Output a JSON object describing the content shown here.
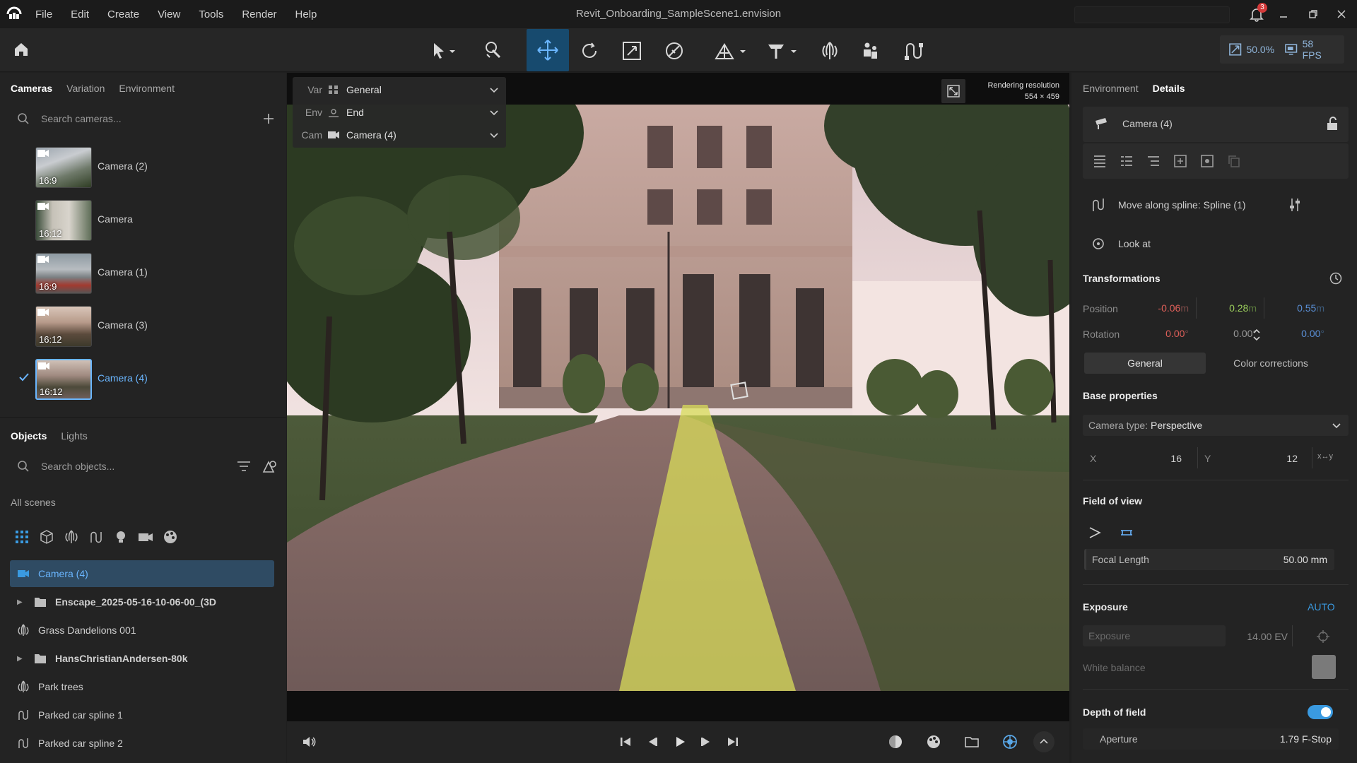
{
  "titlebar": {
    "menu": [
      "File",
      "Edit",
      "Create",
      "View",
      "Tools",
      "Render",
      "Help"
    ],
    "document_title": "Revit_Onboarding_SampleScene1.envision",
    "notification_count": "3"
  },
  "toolbar": {
    "perf_scale": "50.0%",
    "perf_fps": "58 FPS"
  },
  "left": {
    "top_tabs": [
      "Cameras",
      "Variation",
      "Environment"
    ],
    "camera_search_placeholder": "Search cameras...",
    "cameras": [
      {
        "label": "Camera (2)",
        "ratio": "16:9",
        "selected": false
      },
      {
        "label": "Camera",
        "ratio": "16:12",
        "selected": false
      },
      {
        "label": "Camera (1)",
        "ratio": "16:9",
        "selected": false
      },
      {
        "label": "Camera (3)",
        "ratio": "16:12",
        "selected": false
      },
      {
        "label": "Camera (4)",
        "ratio": "16:12",
        "selected": true
      }
    ],
    "bottom_tabs": [
      "Objects",
      "Lights"
    ],
    "object_search_placeholder": "Search objects...",
    "scope_label": "All scenes",
    "objects": [
      {
        "label": "Camera (4)",
        "icon": "camera-icon",
        "expandable": false,
        "selected": true
      },
      {
        "label": "Enscape_2025-05-16-10-06-00_(3D",
        "icon": "folder-icon",
        "expandable": true,
        "selected": false
      },
      {
        "label": "Grass Dandelions 001",
        "icon": "vegetation-icon",
        "expandable": false,
        "selected": false
      },
      {
        "label": "HansChristianAndersen-80k",
        "icon": "folder-icon",
        "expandable": true,
        "selected": false
      },
      {
        "label": "Park trees",
        "icon": "vegetation-icon",
        "expandable": false,
        "selected": false
      },
      {
        "label": "Parked car spline 1",
        "icon": "spline-icon",
        "expandable": false,
        "selected": false
      },
      {
        "label": "Parked car spline 2",
        "icon": "spline-icon",
        "expandable": false,
        "selected": false
      }
    ]
  },
  "viewport": {
    "var_key": "Var",
    "var_value": "General",
    "env_key": "Env",
    "env_value": "End",
    "cam_key": "Cam",
    "cam_value": "Camera (4)",
    "render_res_title": "Rendering resolution",
    "render_res_value": "554 × 459"
  },
  "right": {
    "tabs": [
      "Environment",
      "Details"
    ],
    "object_name": "Camera (4)",
    "spline_label": "Move along spline: Spline (1)",
    "look_at_label": "Look at",
    "transformations_title": "Transformations",
    "position_label": "Position",
    "position": {
      "x": "-0.06",
      "y": "0.28",
      "z": "0.55",
      "unit": "m"
    },
    "rotation_label": "Rotation",
    "rotation": {
      "x": "0.00",
      "y": "0.00",
      "z": "0.00",
      "unit": "°"
    },
    "sub_tabs": [
      "General",
      "Color corrections"
    ],
    "base_props_title": "Base properties",
    "camera_type_label": "Camera type:",
    "camera_type_value": "Perspective",
    "aspect_x_label": "X",
    "aspect_x_value": "16",
    "aspect_y_label": "Y",
    "aspect_y_value": "12",
    "swap_label": "x↔y",
    "fov_title": "Field of view",
    "focal_label": "Focal Length",
    "focal_value": "50.00 mm",
    "exposure_title": "Exposure",
    "exposure_mode": "AUTO",
    "exposure_field_label": "Exposure",
    "exposure_value": "14.00 EV",
    "white_balance_label": "White balance",
    "dof_title": "Depth of field",
    "dof_enabled": true,
    "aperture_label": "Aperture",
    "aperture_value": "1.79 F-Stop"
  },
  "colors": {
    "accent": "#3a9ae0",
    "selection_text": "#6ab6ff",
    "pos_x": "#e0605a",
    "pos_y": "#9ccf5c",
    "pos_z": "#5a8fd6"
  }
}
